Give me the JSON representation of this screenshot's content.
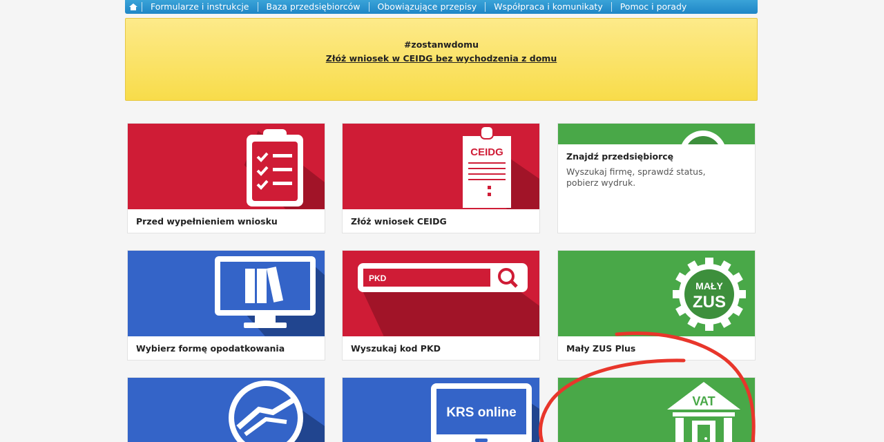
{
  "nav": {
    "items": [
      {
        "label": "Formularze i instrukcje"
      },
      {
        "label": "Baza przedsiębiorców"
      },
      {
        "label": "Obowiązujące przepisy"
      },
      {
        "label": "Współpraca i komunikaty"
      },
      {
        "label": "Pomoc i porady"
      }
    ]
  },
  "banner": {
    "tag": "#zostanwdomu",
    "link": "Złóż wniosek w CEIDG bez wychodzenia z domu"
  },
  "tiles": [
    {
      "title": "Przed wypełnieniem wniosku",
      "icon": "clipboard-checklist-icon",
      "color": "#cf1c36"
    },
    {
      "title": "Złóż wniosek CEIDG",
      "icon_text": "CEIDG",
      "icon": "ceidg-document-icon",
      "color": "#cf1c36"
    },
    {
      "title": "Znajdź przedsiębiorcę",
      "desc": "Wyszukaj firmę, sprawdź status, pobierz wydruk.",
      "color": "#49a848"
    },
    {
      "title": "Wybierz formę opodatkowania",
      "icon": "monitor-binders-icon",
      "color": "#3464c8"
    },
    {
      "title": "Wyszukaj kod PKD",
      "icon_text": "PKD",
      "icon": "search-bar-icon",
      "color": "#cf1c36"
    },
    {
      "title": "Mały ZUS Plus",
      "icon_text_1": "MAŁY",
      "icon_text_2": "ZUS",
      "icon": "gear-badge-icon",
      "color": "#49a848"
    },
    {
      "icon": "handshake-icon",
      "color": "#3464c8"
    },
    {
      "icon_text": "KRS online",
      "icon": "monitor-krs-icon",
      "color": "#3464c8"
    },
    {
      "icon_text": "VAT",
      "icon": "vat-building-icon",
      "color": "#49a848"
    }
  ],
  "annotation_color": "#e8362b"
}
